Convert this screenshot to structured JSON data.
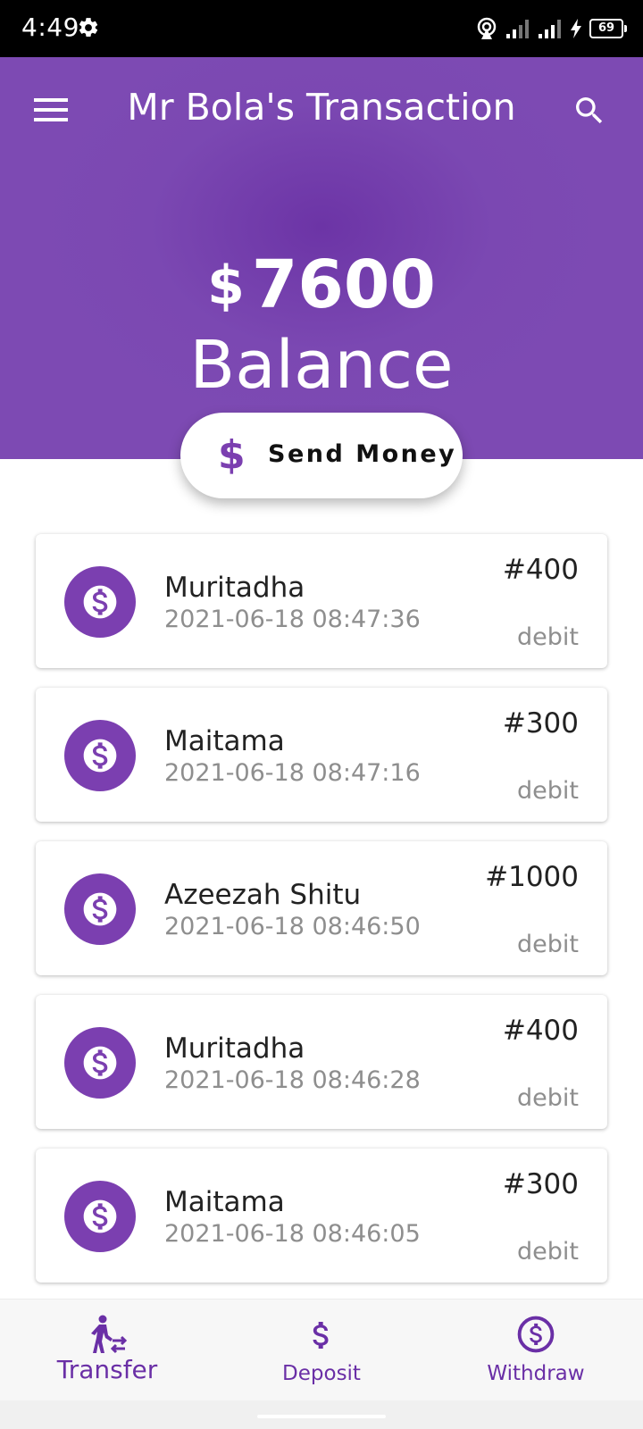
{
  "status_bar": {
    "time": "4:49",
    "battery": "69"
  },
  "header": {
    "title": "Mr Bola's Transaction",
    "balance_currency": "$",
    "balance_amount": "7600",
    "balance_label": "Balance"
  },
  "send_money": {
    "icon": "$",
    "label": "Send Money"
  },
  "transactions": [
    {
      "name": "Muritadha",
      "date": "2021-06-18 08:47:36",
      "amount": "#400",
      "type": "debit"
    },
    {
      "name": "Maitama",
      "date": "2021-06-18 08:47:16",
      "amount": "#300",
      "type": "debit"
    },
    {
      "name": "Azeezah Shitu",
      "date": "2021-06-18 08:46:50",
      "amount": "#1000",
      "type": "debit"
    },
    {
      "name": "Muritadha",
      "date": "2021-06-18 08:46:28",
      "amount": "#400",
      "type": "debit"
    },
    {
      "name": "Maitama",
      "date": "2021-06-18 08:46:05",
      "amount": "#300",
      "type": "debit"
    }
  ],
  "bottom_nav": {
    "items": [
      {
        "label": "Transfer",
        "icon": "transfer-icon",
        "active": true
      },
      {
        "label": "Deposit",
        "icon": "dollar-icon",
        "active": false
      },
      {
        "label": "Withdraw",
        "icon": "dollar-circle-icon",
        "active": false
      }
    ]
  },
  "colors": {
    "primary": "#7b48b2",
    "primary_dark": "#6a2fa6",
    "status_bar": "#000000",
    "text_secondary": "#8e8e8e"
  }
}
